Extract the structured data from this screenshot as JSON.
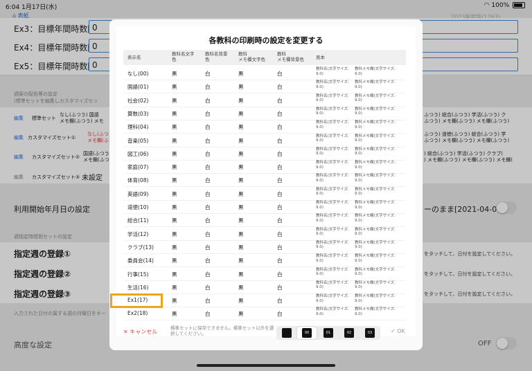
{
  "status": {
    "time": "6:04",
    "date": "1月17日(水)",
    "battery": "100%"
  },
  "nav": {
    "back_label": "表紙",
    "year": "2023年度版(1263)"
  },
  "background": {
    "ex_rows": [
      {
        "label": "Ex3：目標年間時数[0]",
        "value": "0"
      },
      {
        "label": "Ex4：目標年間時数[0]",
        "value": "0"
      },
      {
        "label": "Ex5：目標年間時数[0]",
        "value": "0"
      }
    ],
    "color_section_title": "週案の配色等の設定",
    "color_section_sub": "(標準セットを編集しカスタマイズセッ",
    "sets": [
      {
        "edit": "編集",
        "name": "標準セット",
        "preview": "なし(ふつう) 国語\nメモ欄(ふつう) メモ"
      },
      {
        "edit": "編集",
        "name": "カスタマイズセット①",
        "preview": "なし(ふつう\nメモ欄(ふつう"
      },
      {
        "edit": "編集",
        "name": "カスタマイズセット②",
        "preview": "国語(ふつう\nメモ欄(ふつう"
      },
      {
        "edit": "編集",
        "name": "カスタマイズセット③",
        "preview": "未設定"
      }
    ],
    "right_previews": [
      "ふつう) 総合(ふつう) 学活(ふつう) ク\nふつう) メモ欄(ふつう) メモ欄(ふつう)",
      "ふつう) 道徳(ふつう) 総合(ふつう) 学\nふつう) メモ欄(ふつう) メモ欄(ふつう)",
      ") 総合(ふつう) 学活(ふつう) クラブ(\n) メモ欄(ふつう) メモ欄(ふつう) メモ欄("
    ],
    "start_date_label": "利用開始年月日の設定",
    "start_date_value": "ーのまま[2021-04-01]",
    "week_section_title": "週指定時間割セットの設定",
    "weeks": [
      "指定週の登録①",
      "指定週の登録②",
      "指定週の登録③"
    ],
    "week_hint": "をタッチして、日付を設定してください。",
    "week_note": "入力された日付の属する週の月曜日をキー",
    "advanced_label": "高度な設定",
    "advanced_value": "OFF"
  },
  "modal": {
    "title": "各教科の印刷時の設定を変更する",
    "headers": {
      "name": "表示名",
      "fg": "教科名文字\n色",
      "bg": "教科名背景\n色",
      "memo_fg": "教科\nメモ欄文字色",
      "memo_bg": "教科\nメモ欄背景色",
      "sample": "見本"
    },
    "sample_a": "教科名(文字サイズ:\n9.0)",
    "sample_b": "教科メモ欄(文字サイズ:\n9.0)",
    "rows": [
      {
        "name": "なし(00)",
        "fg": "黒",
        "bg": "白",
        "memo_fg": "黒",
        "memo_bg": "白"
      },
      {
        "name": "国語(01)",
        "fg": "黒",
        "bg": "白",
        "memo_fg": "黒",
        "memo_bg": "白"
      },
      {
        "name": "社会(02)",
        "fg": "黒",
        "bg": "白",
        "memo_fg": "黒",
        "memo_bg": "白"
      },
      {
        "name": "算数(03)",
        "fg": "黒",
        "bg": "白",
        "memo_fg": "黒",
        "memo_bg": "白"
      },
      {
        "name": "理科(04)",
        "fg": "黒",
        "bg": "白",
        "memo_fg": "黒",
        "memo_bg": "白"
      },
      {
        "name": "音楽(05)",
        "fg": "黒",
        "bg": "白",
        "memo_fg": "黒",
        "memo_bg": "白"
      },
      {
        "name": "図工(06)",
        "fg": "黒",
        "bg": "白",
        "memo_fg": "黒",
        "memo_bg": "白"
      },
      {
        "name": "家庭(07)",
        "fg": "黒",
        "bg": "白",
        "memo_fg": "黒",
        "memo_bg": "白"
      },
      {
        "name": "体育(08)",
        "fg": "黒",
        "bg": "白",
        "memo_fg": "黒",
        "memo_bg": "白"
      },
      {
        "name": "英語(09)",
        "fg": "黒",
        "bg": "白",
        "memo_fg": "黒",
        "memo_bg": "白"
      },
      {
        "name": "道徳(10)",
        "fg": "黒",
        "bg": "白",
        "memo_fg": "黒",
        "memo_bg": "白"
      },
      {
        "name": "総合(11)",
        "fg": "黒",
        "bg": "白",
        "memo_fg": "黒",
        "memo_bg": "白"
      },
      {
        "name": "学活(12)",
        "fg": "黒",
        "bg": "白",
        "memo_fg": "黒",
        "memo_bg": "白"
      },
      {
        "name": "クラブ(13)",
        "fg": "黒",
        "bg": "白",
        "memo_fg": "黒",
        "memo_bg": "白"
      },
      {
        "name": "委員会(14)",
        "fg": "黒",
        "bg": "白",
        "memo_fg": "黒",
        "memo_bg": "白"
      },
      {
        "name": "行事(15)",
        "fg": "黒",
        "bg": "白",
        "memo_fg": "黒",
        "memo_bg": "白"
      },
      {
        "name": "生活(16)",
        "fg": "黒",
        "bg": "白",
        "memo_fg": "黒",
        "memo_bg": "白"
      },
      {
        "name": "Ex1(17)",
        "fg": "黒",
        "bg": "白",
        "memo_fg": "黒",
        "memo_bg": "白"
      },
      {
        "name": "Ex2(18)",
        "fg": "黒",
        "bg": "白",
        "memo_fg": "黒",
        "memo_bg": "白"
      }
    ],
    "cancel_label": "キャンセル",
    "footer_note": "標準セットに保存できません。標準セット以外を選択してください。",
    "segments": [
      "00",
      "01",
      "02",
      "03"
    ],
    "ok_label": "OK",
    "highlight_color": "#f0a21b"
  }
}
